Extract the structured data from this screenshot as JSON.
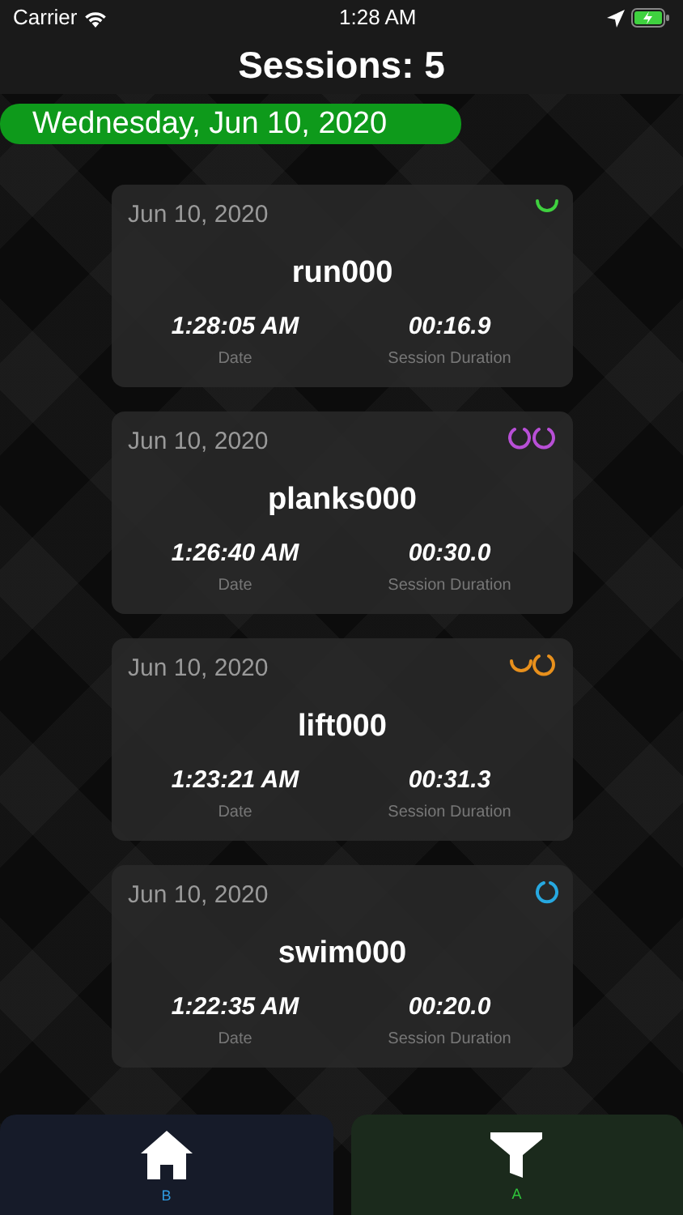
{
  "status_bar": {
    "carrier": "Carrier",
    "time": "1:28 AM"
  },
  "header": {
    "title": "Sessions: 5"
  },
  "date_banner": "Wednesday, Jun 10, 2020",
  "sessions": [
    {
      "date": "Jun 10, 2020",
      "name": "run000",
      "time": "1:28:05 AM",
      "time_label": "Date",
      "duration": "00:16.9",
      "duration_label": "Session Duration",
      "kind": "arc",
      "color": "#3fd13f"
    },
    {
      "date": "Jun 10, 2020",
      "name": "planks000",
      "time": "1:26:40 AM",
      "time_label": "Date",
      "duration": "00:30.0",
      "duration_label": "Session Duration",
      "kind": "double-ring",
      "color": "#b84fd6"
    },
    {
      "date": "Jun 10, 2020",
      "name": "lift000",
      "time": "1:23:21 AM",
      "time_label": "Date",
      "duration": "00:31.3",
      "duration_label": "Session Duration",
      "kind": "arc-ring",
      "color": "#e8901c"
    },
    {
      "date": "Jun 10, 2020",
      "name": "swim000",
      "time": "1:22:35 AM",
      "time_label": "Date",
      "duration": "00:20.0",
      "duration_label": "Session Duration",
      "kind": "ring",
      "color": "#27a8e0"
    }
  ],
  "tab_bar": [
    {
      "label": "B",
      "kind": "home"
    },
    {
      "label": "A",
      "kind": "filter"
    }
  ]
}
